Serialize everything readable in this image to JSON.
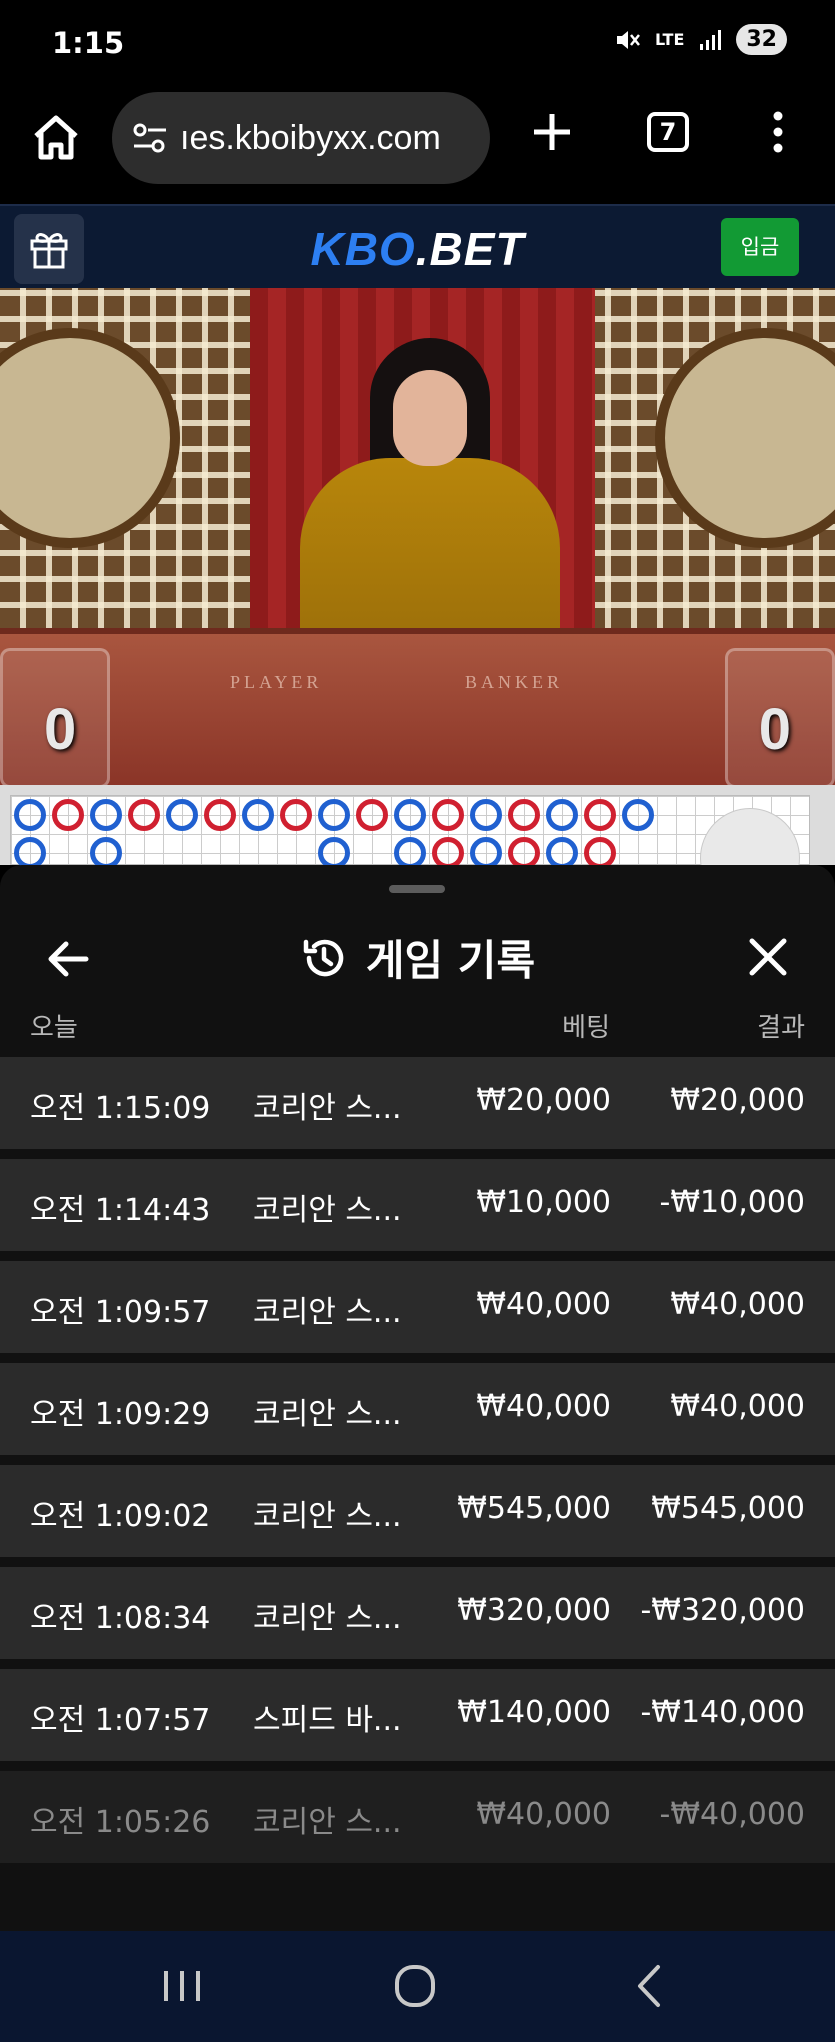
{
  "status_bar": {
    "time": "1:15",
    "lte": "LTE",
    "battery": "32"
  },
  "browser": {
    "url": "ıes.kboibyxx.com",
    "tab_count": "7"
  },
  "site": {
    "logo_part1": "KBO",
    "logo_part2": ".BET",
    "deposit_label": "입금"
  },
  "video": {
    "player_label": "PLAYER",
    "banker_label": "BANKER",
    "player_score": "0",
    "banker_score": "0"
  },
  "sheet": {
    "title": "게임 기록",
    "col_date": "오늘",
    "col_bet": "베팅",
    "col_result": "결과",
    "rows": [
      {
        "time": "오전 1:15:09",
        "game": "코리안 스...",
        "bet": "₩20,000",
        "result": "₩20,000"
      },
      {
        "time": "오전 1:14:43",
        "game": "코리안 스...",
        "bet": "₩10,000",
        "result": "-₩10,000"
      },
      {
        "time": "오전 1:09:57",
        "game": "코리안 스...",
        "bet": "₩40,000",
        "result": "₩40,000"
      },
      {
        "time": "오전 1:09:29",
        "game": "코리안 스...",
        "bet": "₩40,000",
        "result": "₩40,000"
      },
      {
        "time": "오전 1:09:02",
        "game": "코리안 스...",
        "bet": "₩545,000",
        "result": "₩545,000"
      },
      {
        "time": "오전 1:08:34",
        "game": "코리안 스...",
        "bet": "₩320,000",
        "result": "-₩320,000"
      },
      {
        "time": "오전 1:07:57",
        "game": "스피드 바...",
        "bet": "₩140,000",
        "result": "-₩140,000"
      },
      {
        "time": "오전 1:05:26",
        "game": "코리안 스...",
        "bet": "₩40,000",
        "result": "-₩40,000"
      }
    ]
  },
  "colors": {
    "brand_blue": "#2d7ff2",
    "deposit_green": "#129a34",
    "player_blue": "#2060d0",
    "banker_red": "#d02030"
  }
}
